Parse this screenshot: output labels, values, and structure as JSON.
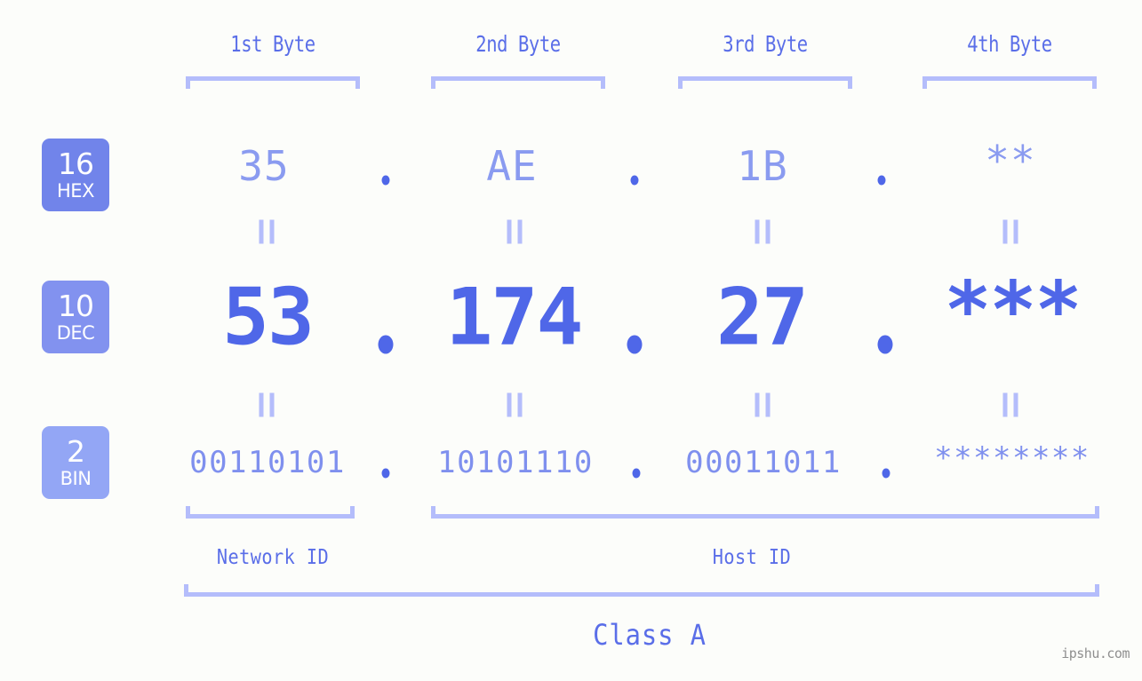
{
  "meta": {
    "watermark": "ipshu.com",
    "accent_dark": "#4f67e8",
    "accent_mid": "#5a6ee8",
    "accent_light": "#8a9bf0",
    "bracket_color": "#b4bdfb",
    "background": "#fcfdfa"
  },
  "byte_headers": [
    {
      "label": "1st Byte"
    },
    {
      "label": "2nd Byte"
    },
    {
      "label": "3rd Byte"
    },
    {
      "label": "4th Byte"
    }
  ],
  "bases": [
    {
      "num": "16",
      "name": "HEX",
      "color": "#7184ea"
    },
    {
      "num": "10",
      "name": "DEC",
      "color": "#8292ef"
    },
    {
      "num": "2",
      "name": "BIN",
      "color": "#93a6f5"
    }
  ],
  "rows": {
    "hex": {
      "base": "16",
      "values": [
        "35",
        "AE",
        "1B",
        "**"
      ],
      "separator": "."
    },
    "dec": {
      "base": "10",
      "values": [
        "53",
        "174",
        "27",
        "***"
      ],
      "separator": "."
    },
    "bin": {
      "base": "2",
      "values": [
        "00110101",
        "10101110",
        "00011011",
        "********"
      ],
      "separator": "."
    }
  },
  "segments": {
    "network_id": "Network ID",
    "host_id": "Host ID",
    "class": "Class A"
  },
  "equals_marks": {
    "glyph": "||",
    "count_per_row": 4
  }
}
